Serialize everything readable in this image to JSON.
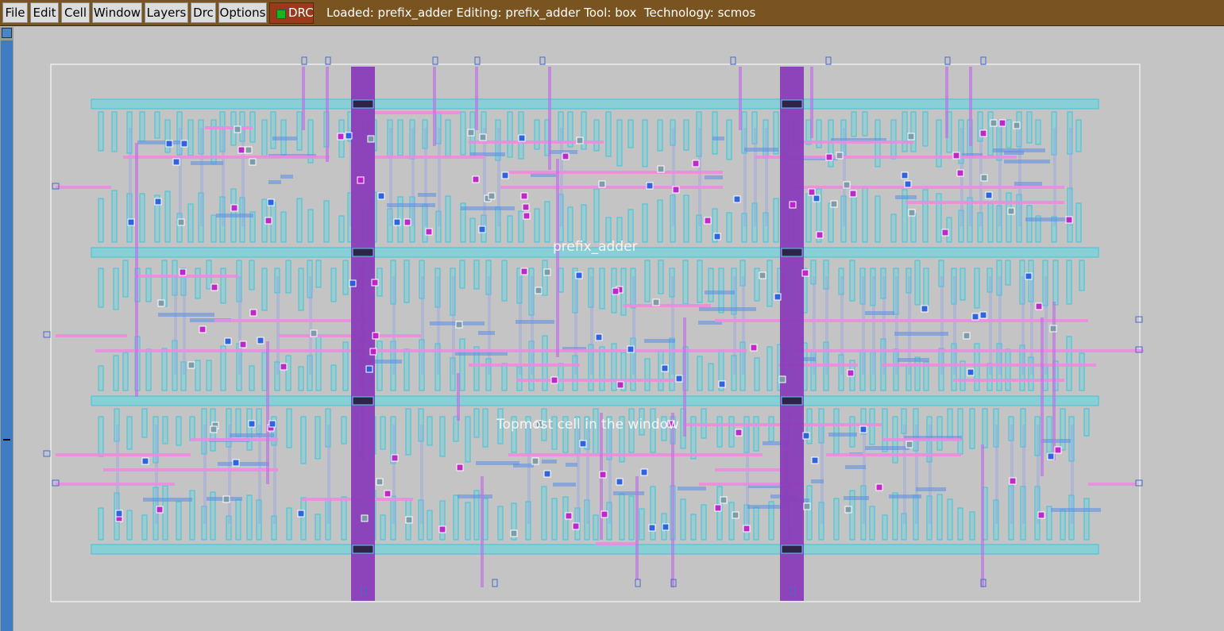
{
  "menubar": {
    "items": [
      {
        "id": "file",
        "label": "File"
      },
      {
        "id": "edit",
        "label": "Edit"
      },
      {
        "id": "cell",
        "label": "Cell"
      },
      {
        "id": "window",
        "label": "Window"
      },
      {
        "id": "layers",
        "label": "Layers"
      },
      {
        "id": "drc",
        "label": "Drc"
      },
      {
        "id": "options",
        "label": "Options"
      }
    ],
    "drc_indicator": {
      "label": "DRC",
      "status_color": "#1bb51b"
    }
  },
  "status_bar": {
    "text": "Loaded: prefix_adder Editing: prefix_adder Tool: box  Technology: scmos"
  },
  "layout": {
    "cell_name": "prefix_adder",
    "topmost_label": "Topmost cell in the window",
    "colors": {
      "background": "#c4c4c4",
      "metal1": "#57d9e6",
      "metal2": "#bf6fe6",
      "metal3": "#8a3cb8",
      "poly": "#f08ae0",
      "contact": "#c020c8",
      "cell_boundary": "#ffffff"
    }
  }
}
